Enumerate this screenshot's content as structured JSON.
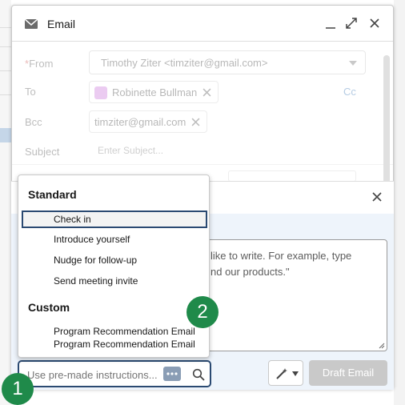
{
  "email": {
    "title": "Email",
    "from_label": "From",
    "from_required_mark": "*",
    "from_value": "Timothy Ziter <timziter@gmail.com>",
    "to_label": "To",
    "to_recipient": "Robinette Bullman",
    "cc_label": "Cc",
    "bcc_label": "Bcc",
    "bcc_recipient": "timziter@gmail.com",
    "subject_label": "Subject",
    "subject_placeholder": "Enter Subject..."
  },
  "assistant": {
    "prompt_line1": "like to write. For example, type",
    "prompt_line2": "nd our products.\"",
    "search_placeholder": "Use pre-made instructions...",
    "draft_button": "Draft Email"
  },
  "dropdown": {
    "standard_label": "Standard",
    "standard_items": [
      "Check in",
      "Introduce yourself",
      "Nudge for follow-up",
      "Send meeting invite"
    ],
    "custom_label": "Custom",
    "custom_item_line1": "Program Recommendation Email",
    "custom_item_line2": "Program Recommendation Email"
  },
  "badges": {
    "first": "1",
    "second": "2"
  },
  "colors": {
    "badge": "#1f8a4a",
    "focus_border": "#2b4a72",
    "draft_disabled": "#c9c9c9"
  },
  "icons": [
    "envelope-icon",
    "minimize-icon",
    "expand-icon",
    "close-icon",
    "chevron-down-icon",
    "contact-icon",
    "remove-icon",
    "more-icon",
    "search-icon",
    "magic-wand-icon"
  ]
}
